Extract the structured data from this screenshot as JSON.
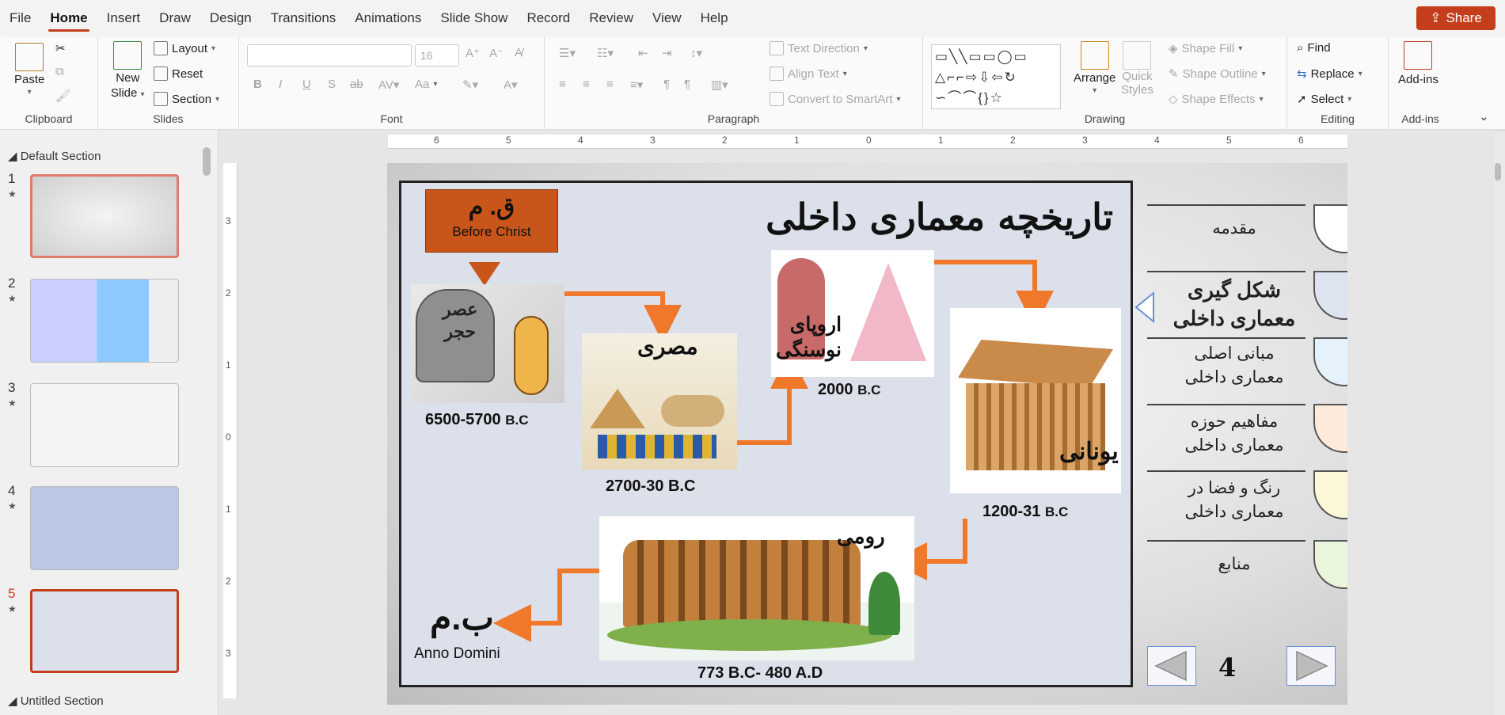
{
  "menu": {
    "tabs": [
      "File",
      "Home",
      "Insert",
      "Draw",
      "Design",
      "Transitions",
      "Animations",
      "Slide Show",
      "Record",
      "Review",
      "View",
      "Help"
    ],
    "active": "Home",
    "share": "Share"
  },
  "ribbon": {
    "clipboard": {
      "paste": "Paste",
      "label": "Clipboard"
    },
    "slides": {
      "new_slide": "New",
      "new_slide2": "Slide",
      "layout": "Layout",
      "reset": "Reset",
      "section": "Section",
      "label": "Slides"
    },
    "font": {
      "size": "16",
      "label": "Font",
      "bold": "B",
      "italic": "I",
      "underline": "U",
      "shadow": "S",
      "strike": "ab",
      "case": "Aa"
    },
    "paragraph": {
      "text_direction": "Text Direction",
      "align_text": "Align Text",
      "convert": "Convert to SmartArt",
      "label": "Paragraph"
    },
    "drawing": {
      "arrange": "Arrange",
      "quick_styles": "Quick",
      "quick_styles2": "Styles",
      "shape_fill": "Shape Fill",
      "shape_outline": "Shape Outline",
      "shape_effects": "Shape Effects",
      "label": "Drawing"
    },
    "editing": {
      "find": "Find",
      "replace": "Replace",
      "select": "Select",
      "label": "Editing"
    },
    "addins": {
      "btn": "Add-ins",
      "label": "Add-ins"
    }
  },
  "panel": {
    "section1": "Default Section",
    "section2": "Untitled Section",
    "slides": [
      "1",
      "2",
      "3",
      "4",
      "5"
    ],
    "selected": "5"
  },
  "ruler": {
    "h": [
      "6",
      "5",
      "4",
      "3",
      "2",
      "1",
      "0",
      "1",
      "2",
      "3",
      "4",
      "5",
      "6"
    ],
    "v": [
      "3",
      "2",
      "1",
      "0",
      "1",
      "2",
      "3"
    ]
  },
  "slide": {
    "title": "تاریخچه معماری داخلی",
    "bc_fa": "ق. م",
    "bc_en": "Before Christ",
    "stone_age": "عصر\nحجر",
    "stone_date": "6500-5700",
    "egypt": "مصری",
    "egypt_date": "2700-30 B.C",
    "europe": "اروپای\nنوسنگی",
    "europe_date": "2000",
    "greek": "یونانی",
    "greek_date": "1200-31",
    "roman": "رومی",
    "roman_date": "773 B.C- 480 A.D",
    "ad_fa": "ب.م",
    "ad_en": "Anno Domini",
    "bc_suffix": "B.C",
    "nav": [
      "مقدمه",
      "شکل گیری\nمعماری داخلی",
      "مبانی اصلی\nمعماری داخلی",
      "مفاهیم حوزه\nمعماری داخلی",
      "رنگ و فضا در\nمعماری داخلی",
      "منابع"
    ],
    "nav_colors": [
      "#ffffff",
      "#dde3ef",
      "#e6f2fb",
      "#fdeadb",
      "#fdf9d8",
      "#e9f6dc"
    ],
    "page": "4"
  }
}
